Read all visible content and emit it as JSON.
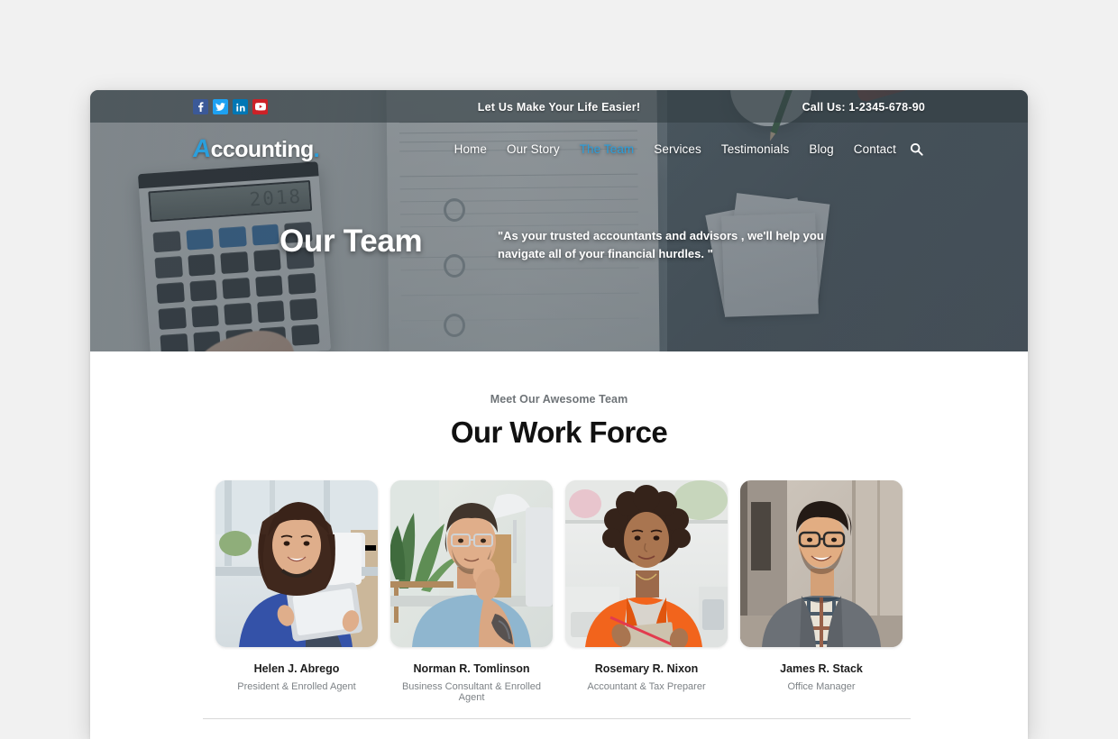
{
  "topbar": {
    "tagline": "Let Us Make Your Life Easier!",
    "call_label": "Call Us: 1-2345-678-90",
    "social": [
      {
        "name": "facebook-icon",
        "label": "f",
        "color": "#3b5998"
      },
      {
        "name": "twitter-icon",
        "label": "t",
        "color": "#1da1f2"
      },
      {
        "name": "linkedin-icon",
        "label": "in",
        "color": "#0077b5"
      },
      {
        "name": "youtube-icon",
        "label": "yt",
        "color": "#cc2127"
      }
    ]
  },
  "brand": {
    "mark": "A",
    "name": "ccounting",
    "dot": ".",
    "accent_color": "#2b9fdc"
  },
  "nav": {
    "items": [
      {
        "label": "Home",
        "active": false
      },
      {
        "label": "Our Story",
        "active": false
      },
      {
        "label": "The Team",
        "active": true
      },
      {
        "label": "Services",
        "active": false
      },
      {
        "label": "Testimonials",
        "active": false
      },
      {
        "label": "Blog",
        "active": false
      },
      {
        "label": "Contact",
        "active": false
      }
    ],
    "search_icon": "search-icon"
  },
  "hero": {
    "title": "Our Team",
    "quote": "\"As your trusted accountants and advisors , we'll help you navigate all of your financial hurdles. \"",
    "background_color": "#49545c"
  },
  "team": {
    "eyebrow": "Meet Our Awesome Team",
    "title": "Our Work Force",
    "members": [
      {
        "name": "Helen J. Abrego",
        "role": "President & Enrolled Agent",
        "photo": "woman-with-tablet-blue-sweater"
      },
      {
        "name": "Norman R. Tomlinson",
        "role": "Business Consultant & Enrolled Agent",
        "photo": "man-glasses-blue-tshirt-tattoo"
      },
      {
        "name": "Rosemary R. Nixon",
        "role": "Accountant & Tax Preparer",
        "photo": "woman-orange-blazer-notebook"
      },
      {
        "name": "James R. Stack",
        "role": "Office Manager",
        "photo": "man-grey-blazer-plaid-shirt"
      }
    ]
  }
}
